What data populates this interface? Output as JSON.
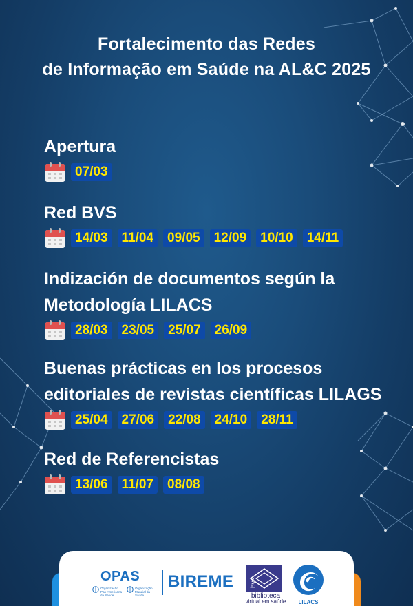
{
  "title": {
    "line1": "Fortalecimento das Redes",
    "line2": "de Informação em Saúde na AL&C 2025"
  },
  "sections": [
    {
      "title_lines": [
        "Apertura"
      ],
      "dates": [
        "07/03"
      ]
    },
    {
      "title_lines": [
        "Red BVS"
      ],
      "dates": [
        "14/03",
        "11/04",
        "09/05",
        "12/09",
        "10/10",
        "14/11"
      ]
    },
    {
      "title_lines": [
        "Indización de documentos según la",
        "Metodología LILACS"
      ],
      "dates": [
        "28/03",
        "23/05",
        "25/07",
        "26/09"
      ]
    },
    {
      "title_lines": [
        "Buenas prácticas en los procesos",
        "editoriales de revistas científicas LILAGS"
      ],
      "dates": [
        "25/04",
        "27/06",
        "22/08",
        "24/10",
        "28/11"
      ]
    },
    {
      "title_lines": [
        "Red de Referencistas"
      ],
      "dates": [
        "13/06",
        "11/07",
        "08/08"
      ]
    }
  ],
  "logos": {
    "opas": "OPAS",
    "opas_sub_1": "Organização Pan-Americana da Saúde",
    "opas_sub_2": "Organização Mundial da Saúde",
    "bireme": "BIREME",
    "bvs": "bvs",
    "bvs_sub_1": "biblioteca",
    "bvs_sub_2": "virtual em saúde",
    "lilacs": "LILACS"
  },
  "colors": {
    "background": "#1a4c7a",
    "title_text": "#ffffff",
    "date_chip_bg": "#0e4aa8",
    "date_text": "#ffe600",
    "logo_blue": "#1b6fc0",
    "accent_orange": "#f08a1c"
  },
  "icons": {
    "date_icon": "calendar-icon"
  }
}
